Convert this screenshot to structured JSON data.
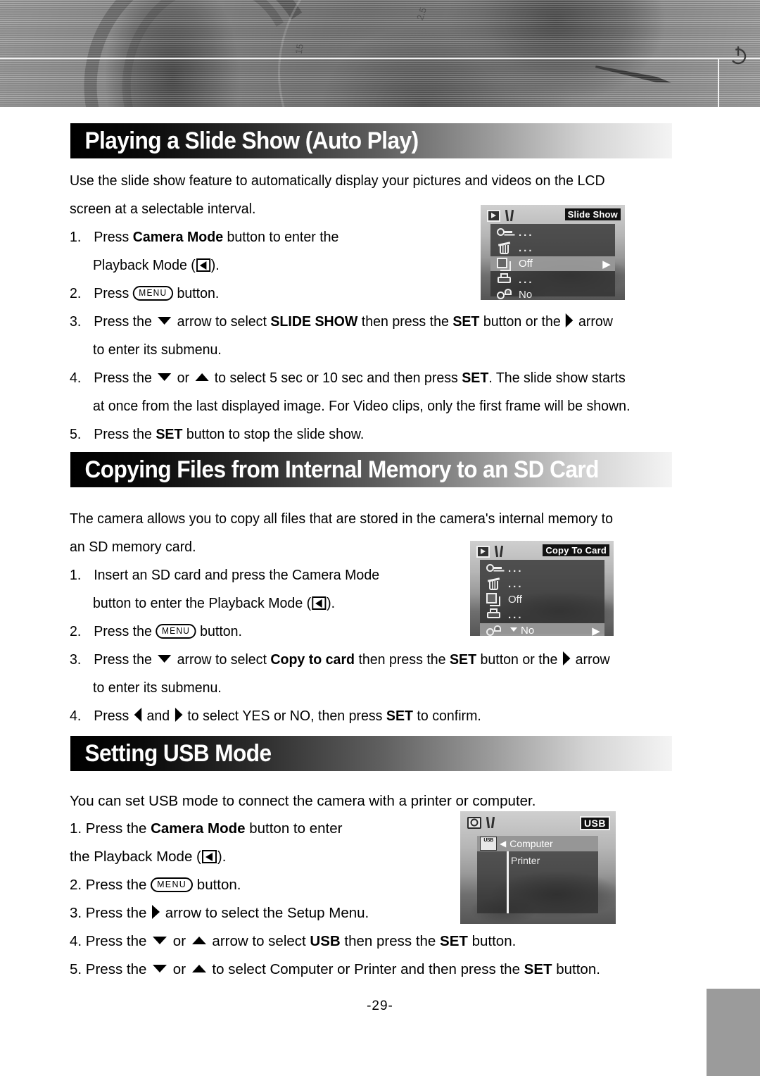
{
  "page": {
    "number": "-29-",
    "power_icon": "power-icon"
  },
  "sections": [
    {
      "heading": "Playing a Slide Show (Auto Play)",
      "intro": [
        "Use the slide show feature to automatically display your pictures and videos on the LCD",
        "screen at a selectable interval."
      ],
      "steps": [
        {
          "num": "1.",
          "parts": [
            "Press ",
            "Camera Mode",
            " button to enter the"
          ]
        },
        {
          "num": "",
          "parts": [
            "Playback Mode (",
            "playback-icon",
            ")."
          ]
        },
        {
          "num": "2.",
          "parts": [
            "Press ",
            "MENU",
            " button."
          ]
        },
        {
          "num": "3.",
          "parts": [
            "Press the ",
            "down-arrow",
            " arrow to select ",
            "SLIDE SHOW",
            " then press the ",
            "SET",
            " button or the ",
            "right-arrow",
            " arrow"
          ]
        },
        {
          "num": "",
          "parts": [
            "to enter its submenu."
          ]
        },
        {
          "num": "4.",
          "parts": [
            "Press the ",
            "down-arrow",
            " or ",
            "up-arrow",
            " to select 5 sec or 10 sec and then press ",
            "SET",
            ". The slide show starts"
          ]
        },
        {
          "num": "",
          "parts": [
            "at once from the last displayed image. For Video clips, only the first frame will be shown."
          ]
        },
        {
          "num": "5.",
          "parts": [
            "Press the ",
            "SET",
            " button to stop the slide show."
          ]
        }
      ],
      "lcd": {
        "title": "Slide Show",
        "tabs": [
          "playback-icon",
          "wrench-icon"
        ],
        "rows": [
          {
            "icon": "key-icon",
            "value": "...",
            "selected": false,
            "arrow": ""
          },
          {
            "icon": "trash-icon",
            "value": "...",
            "selected": false,
            "arrow": ""
          },
          {
            "icon": "slideshow-icon",
            "value": "Off",
            "selected": true,
            "arrow": "▶"
          },
          {
            "icon": "printer-icon",
            "value": "...",
            "selected": false,
            "arrow": ""
          },
          {
            "icon": "copy-icon",
            "value": "No",
            "selected": false,
            "arrow": ""
          }
        ]
      }
    },
    {
      "heading": "Copying Files from Internal Memory to an SD Card",
      "intro": [
        "The camera allows you to copy all files that are stored in the camera's internal memory to",
        "an SD memory card."
      ],
      "steps": [
        {
          "num": "1.",
          "parts": [
            "Insert an SD card and press the Camera Mode"
          ]
        },
        {
          "num": "",
          "parts": [
            "button to enter the Playback Mode (",
            "playback-icon",
            ")."
          ]
        },
        {
          "num": "2.",
          "parts": [
            "Press the ",
            "MENU",
            " button."
          ]
        },
        {
          "num": "3.",
          "parts": [
            "Press the ",
            "down-arrow",
            " arrow to select ",
            "Copy to card",
            " then press the ",
            "SET",
            " button or the ",
            "right-arrow",
            " arrow"
          ]
        },
        {
          "num": "",
          "parts": [
            "to enter its submenu."
          ]
        },
        {
          "num": "4.",
          "parts": [
            "Press ",
            "left-arrow",
            " and ",
            "right-arrow",
            " to select YES or NO, then press ",
            "SET",
            " to confirm."
          ]
        }
      ],
      "lcd": {
        "title": "Copy To Card",
        "tabs": [
          "playback-icon",
          "wrench-icon"
        ],
        "rows": [
          {
            "icon": "key-icon",
            "value": "...",
            "selected": false,
            "arrow": ""
          },
          {
            "icon": "trash-icon",
            "value": "...",
            "selected": false,
            "arrow": ""
          },
          {
            "icon": "slideshow-icon",
            "value": "Off",
            "selected": false,
            "arrow": ""
          },
          {
            "icon": "printer-icon",
            "value": "...",
            "selected": false,
            "arrow": ""
          },
          {
            "icon": "copy-icon",
            "value": "No",
            "selected": true,
            "arrow": "▶"
          }
        ]
      }
    },
    {
      "heading": "Setting USB Mode",
      "intro": [
        "You can set USB mode to connect the camera with a printer or computer."
      ],
      "steps": [
        {
          "num": "1.",
          "parts": [
            "Press the ",
            "Camera Mode",
            " button to enter"
          ]
        },
        {
          "num": "",
          "parts": [
            "the Playback Mode (",
            "playback-icon",
            ")."
          ]
        },
        {
          "num": "2.",
          "parts": [
            "Press the ",
            "MENU",
            " button."
          ]
        },
        {
          "num": "3.",
          "parts": [
            "Press the ",
            "right-arrow",
            " arrow to select the Setup Menu."
          ]
        },
        {
          "num": "4.",
          "parts": [
            "Press the ",
            "down-arrow",
            " or ",
            "up-arrow",
            " arrow to select ",
            "USB",
            " then press the ",
            "SET",
            " button."
          ]
        },
        {
          "num": "5.",
          "parts": [
            "Press the ",
            "down-arrow",
            " or ",
            "up-arrow",
            " to select Computer or Printer and then press the ",
            "SET",
            " button."
          ]
        }
      ],
      "lcd": {
        "title": "USB",
        "tabs": [
          "camera-icon",
          "wrench-icon"
        ],
        "rows": [
          {
            "icon": "usb-icon",
            "value": "Computer",
            "selected": true,
            "arrow": "◀"
          },
          {
            "icon": "",
            "value": "Printer",
            "selected": false,
            "arrow": ""
          }
        ]
      }
    }
  ],
  "labels": {
    "menu_button": "MENU",
    "set": "SET",
    "dots": "...",
    "usb_badge": "USB",
    "computer": "Computer",
    "printer": "Printer"
  },
  "colors": {
    "heading_start": "#000000",
    "heading_end": "#f4f4f4",
    "lcd_selected": "#aaaaaa",
    "corner_tab": "#9b9b9b",
    "text": "#000000"
  }
}
